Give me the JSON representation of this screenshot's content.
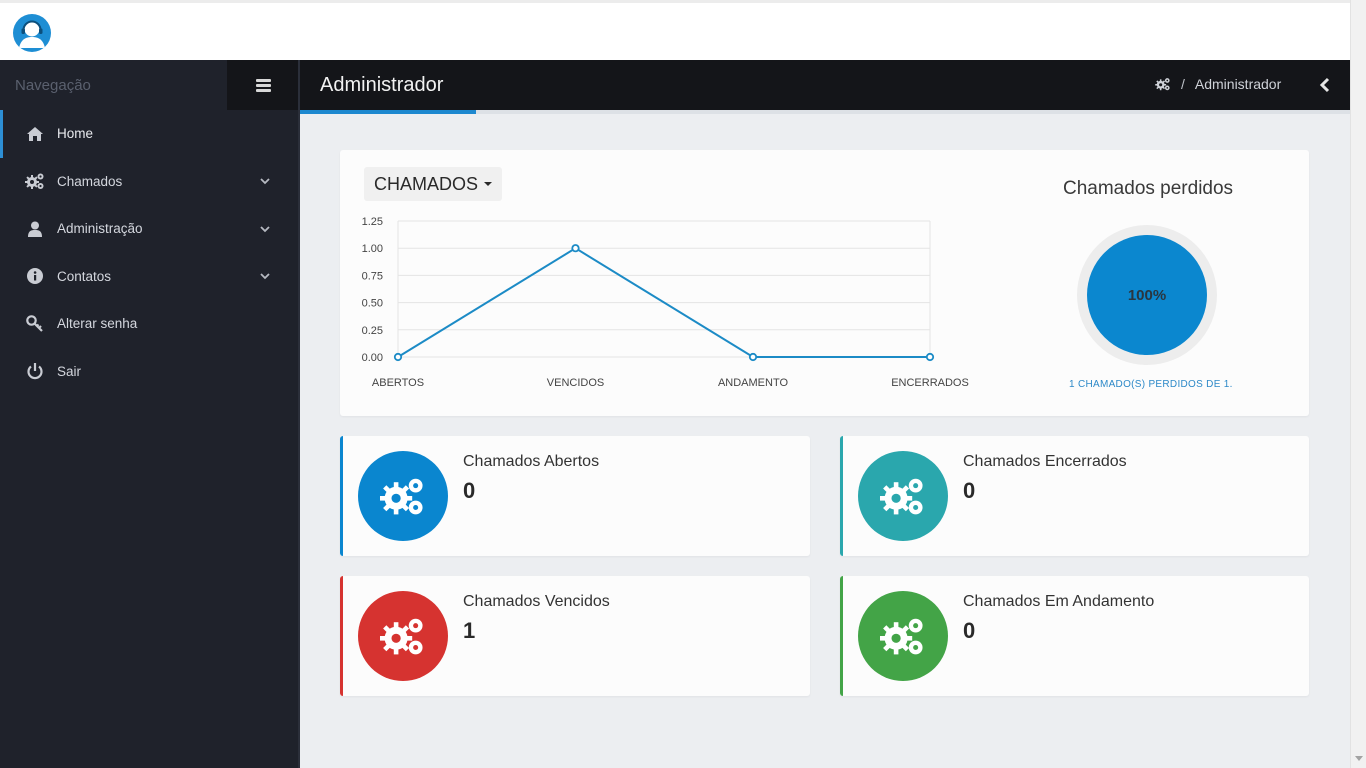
{
  "sidebar": {
    "nav_title": "Navegação",
    "items": [
      {
        "label": "Home"
      },
      {
        "label": "Chamados"
      },
      {
        "label": "Administração"
      },
      {
        "label": "Contatos"
      },
      {
        "label": "Alterar senha"
      },
      {
        "label": "Sair"
      }
    ]
  },
  "header": {
    "page_title": "Administrador",
    "breadcrumb_separator": "/",
    "breadcrumb_current": "Administrador"
  },
  "chart_panel": {
    "dropdown_label": "CHAMADOS",
    "donut": {
      "title": "Chamados perdidos",
      "percent_label": "100%",
      "percent": 100,
      "caption": "1 CHAMADO(S) PERDIDOS DE 1."
    }
  },
  "chart_data": {
    "type": "line",
    "categories": [
      "ABERTOS",
      "VENCIDOS",
      "ANDAMENTO",
      "ENCERRADOS"
    ],
    "values": [
      0,
      1,
      0,
      0
    ],
    "ylim": [
      0,
      1.25
    ],
    "y_ticks": [
      "0.00",
      "0.25",
      "0.50",
      "0.75",
      "1.00",
      "1.25"
    ],
    "grid": true,
    "color": "#1c8bc6"
  },
  "cards": [
    {
      "label": "Chamados Abertos",
      "value": "0",
      "color": "#0a86cf"
    },
    {
      "label": "Chamados Encerrados",
      "value": "0",
      "color": "#2aa7ad"
    },
    {
      "label": "Chamados Vencidos",
      "value": "1",
      "color": "#d63330"
    },
    {
      "label": "Chamados Em Andamento",
      "value": "0",
      "color": "#43a447"
    }
  ],
  "icons": {
    "logo": "user-headset-icon",
    "cards": "gears-icon"
  }
}
